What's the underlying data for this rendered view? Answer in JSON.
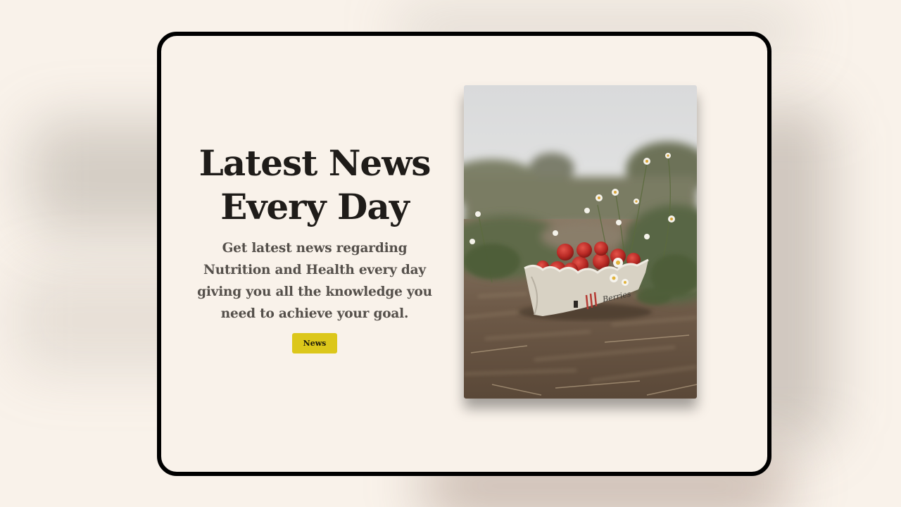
{
  "hero": {
    "title_line1": "Latest News",
    "title_line2": "Every Day",
    "description": "Get latest news regarding Nutrition and Health every day giving you all the knowledge you need to achieve your goal.",
    "button_label": "News",
    "button_color": "#dcc71a"
  },
  "photo": {
    "subject": "basket-of-strawberries-in-field",
    "carton_text": "Berries"
  },
  "colors": {
    "background": "#f9f2ea",
    "card_border": "#000000",
    "heading": "#1f1c19",
    "body_text": "#55504b"
  }
}
